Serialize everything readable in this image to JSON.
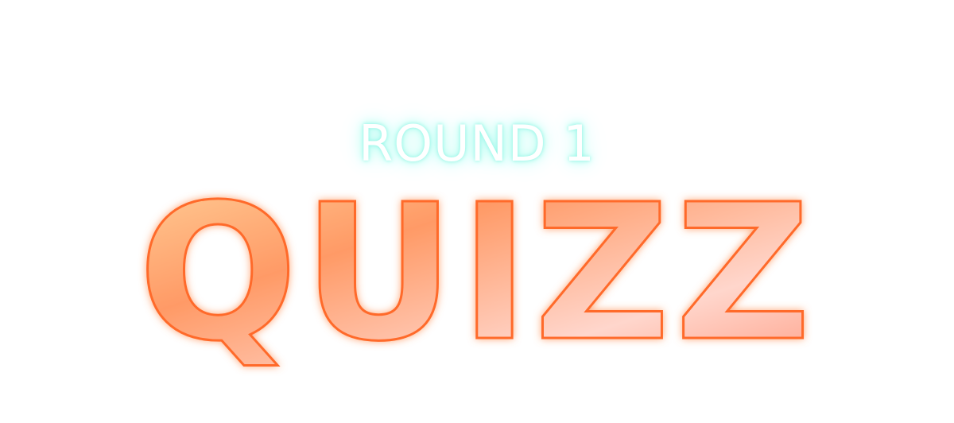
{
  "screen": {
    "subtitle": "ROUND 1",
    "title": "QUIZZ"
  },
  "colors": {
    "subtitle_fill": "#ffffff",
    "subtitle_glow": "#a8fbef",
    "title_gradient_start": "#ffd29a",
    "title_gradient_mid": "#ff9a66",
    "title_gradient_light": "#ffd6cc",
    "title_gradient_end": "#ff9a80",
    "title_outline": "#ff6a2c",
    "title_glow": "#ff8a4a"
  }
}
